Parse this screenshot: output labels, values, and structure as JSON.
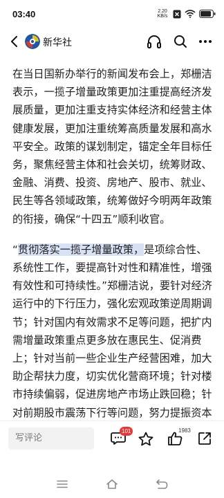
{
  "status_bar": {
    "time": "03:40",
    "net_speed_value": "2.20",
    "net_speed_unit": "KB/s",
    "icons": [
      "network-speed-icon",
      "close-box-icon",
      "wifi-icon",
      "battery-icon"
    ]
  },
  "header": {
    "source_name": "新华社",
    "icons": [
      "back-arrow-icon",
      "xinhua-logo-icon",
      "headphones-icon",
      "search-icon",
      "more-icon"
    ]
  },
  "article": {
    "para1": "在当日国新办举行的新闻发布会上，郑栅洁表示，一揽子增量政策更加注重提高经济发展质量，更加注重支持实体经济和经营主体健康发展，更加注重统筹高质量发展和高水平安全。政策的谋划制定，锚定全年目标任务，聚焦经营主体和社会关切，统筹财政、金融、消费、投资、房地产、股市、就业、民生等各领域政策，统筹做好今明两年政策的衔接，确保“十四五”顺利收官。",
    "para2_open_quote": "“",
    "para2_highlight": "贯彻落实一揽子增量政策，",
    "para2_rest": "是项综合性、系统性工作，要提高针对性和精准性，增强有效性和可持续性。”郑栅洁说，要针对经济运行中的下行压力，强化宏观政策逆周期调节；针对国内有效需求不足等问题，把扩内需增量政策重点更多放在惠民生、促消费上；针对当前一些企业生产经营困难，加大助企帮扶力度，切实优化营商环境；针对楼市持续偏弱，促进房地产市场止跌回稳；针对前期股市震荡下行等问题，努力提振资本市场。",
    "highlight_color": "#d7e2f4"
  },
  "bottom_bar": {
    "comment_placeholder": "写评论",
    "comment_count": "101",
    "like_count": "1983",
    "badge_color": "#e9363a",
    "icons": [
      "comment-icon",
      "star-icon",
      "thumb-up-icon",
      "share-icon"
    ]
  },
  "nav_bar": {
    "icons": [
      "menu-icon",
      "home-icon",
      "back-icon"
    ]
  }
}
